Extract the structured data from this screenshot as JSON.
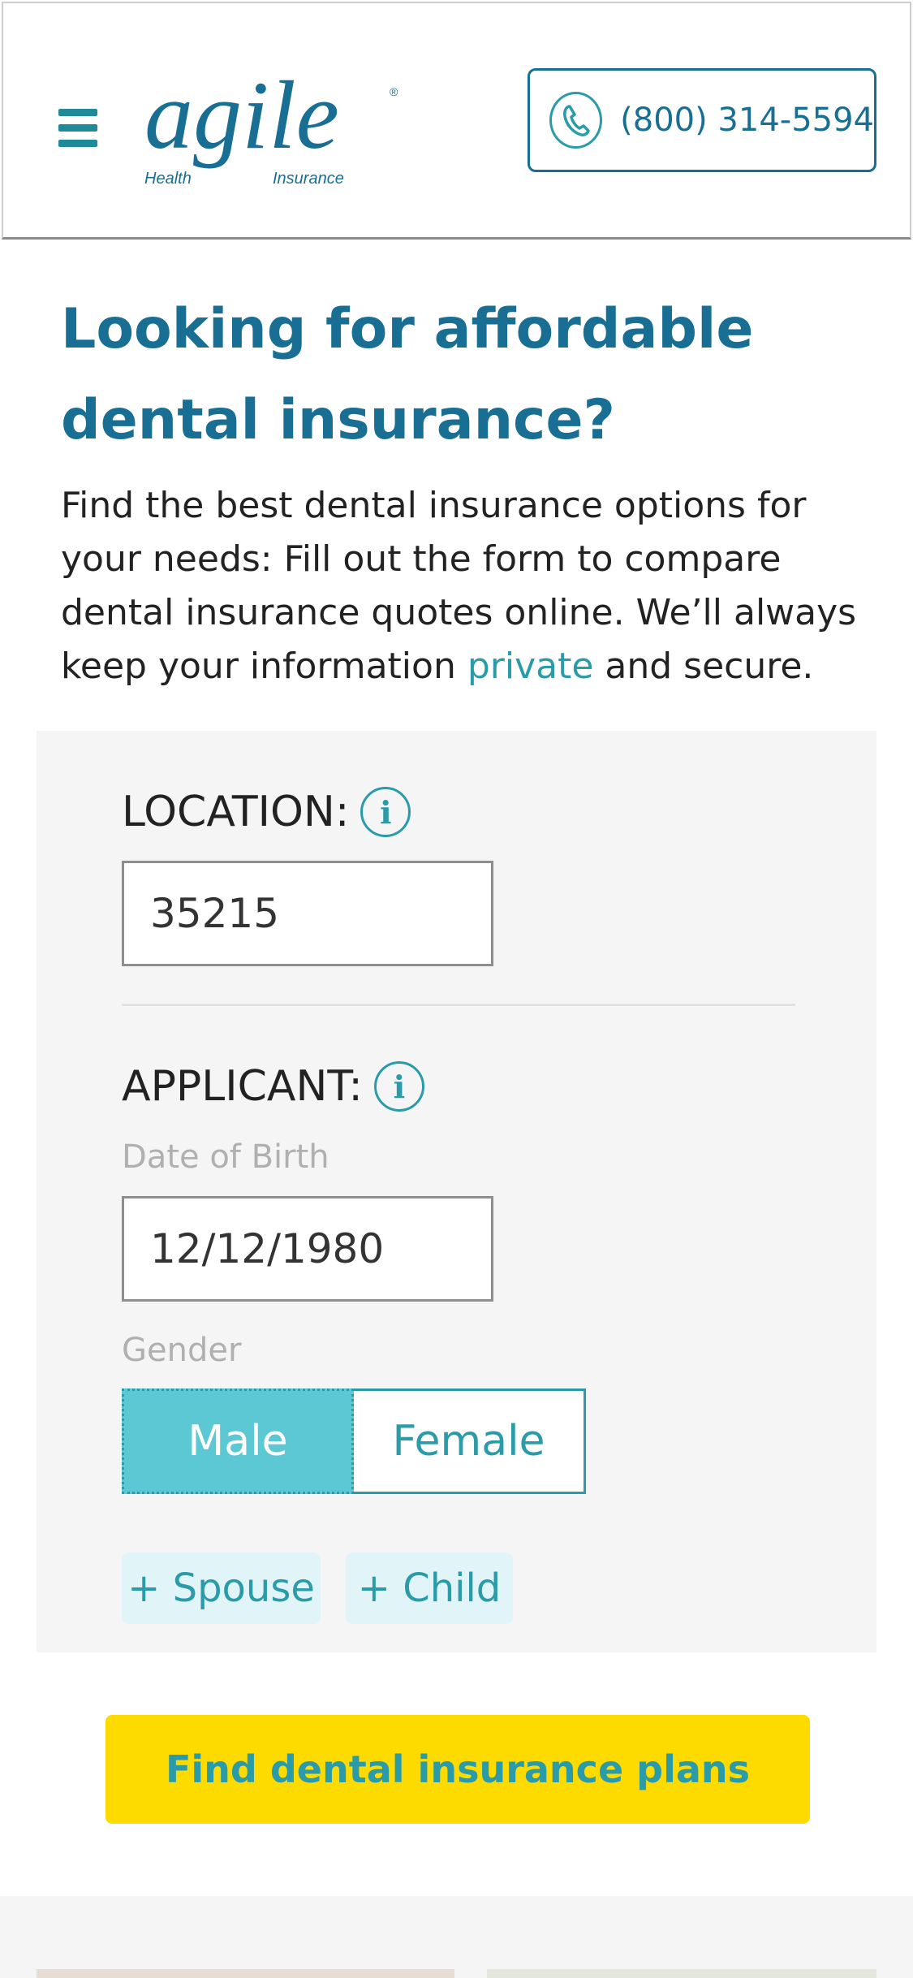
{
  "header": {
    "logo": {
      "brand": "agile",
      "sub_left": "Health",
      "sub_right": "Insurance",
      "registered": "®"
    },
    "phone": "(800) 314-5594"
  },
  "main": {
    "headline": "Looking for affordable dental insurance?",
    "intro_before": "Find the best dental insurance options for your needs: Fill out the form to compare dental insurance quotes online. We’ll always keep your information ",
    "intro_link": "private",
    "intro_after": " and secure."
  },
  "form": {
    "location_label": "LOCATION:",
    "zip_value": "35215",
    "applicant_label": "APPLICANT:",
    "dob_caption": "Date of Birth",
    "dob_value": "12/12/1980",
    "gender_caption": "Gender",
    "gender_options": [
      "Male",
      "Female"
    ],
    "gender_selected": "Male",
    "add_spouse": "+ Spouse",
    "add_child": "+ Child",
    "info_glyph": "i"
  },
  "cta": {
    "label": "Find dental insurance plans"
  },
  "colors": {
    "brand_blue": "#186f93",
    "teal": "#2a9ba8",
    "selected_teal": "#5bc8d3",
    "cta_yellow": "#fdda00",
    "panel_gray": "#f5f5f5"
  },
  "icons": [
    "menu-icon",
    "phone-icon",
    "info-icon"
  ]
}
